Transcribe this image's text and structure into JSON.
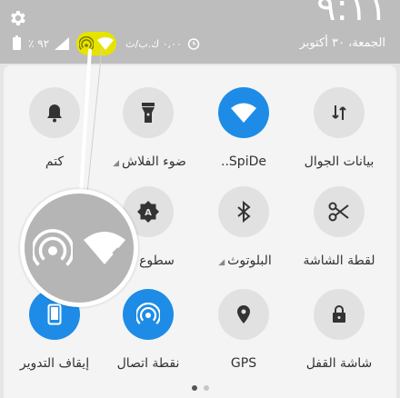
{
  "status_bar": {
    "time": "٩:١١",
    "date": "الجمعة، ٣٠ أكتوبر",
    "battery": "٪ ٩٢",
    "net_speed": "٠,٠٠ ك.ب/ث",
    "icons": [
      "gear-icon",
      "battery-icon",
      "signal-icon",
      "hotspot-icon",
      "wifi-icon",
      "alarm-icon"
    ],
    "highlight_color": "#e6e300"
  },
  "tiles": [
    {
      "label": "بيانات الجوال",
      "icon": "mobile-data-icon",
      "active": false,
      "has_arrow": false
    },
    {
      "label": "SpiDe..",
      "icon": "wifi-icon",
      "active": true,
      "has_arrow": false
    },
    {
      "label": "ضوء الفلاش",
      "icon": "flashlight-icon",
      "active": false,
      "has_arrow": true
    },
    {
      "label": "كتم",
      "icon": "bell-icon",
      "active": false,
      "has_arrow": false
    },
    {
      "label": "لقطة الشاشة",
      "icon": "scissors-icon",
      "active": false,
      "has_arrow": false
    },
    {
      "label": "البلوتوث",
      "icon": "bluetooth-icon",
      "active": false,
      "has_arrow": true
    },
    {
      "label": "سطوع تل",
      "icon": "auto-brightness-icon",
      "active": false,
      "has_arrow": false
    },
    {
      "label": "شاشة القفل",
      "icon": "lock-icon",
      "active": false,
      "has_arrow": false
    },
    {
      "label": "GPS",
      "icon": "location-icon",
      "active": false,
      "has_arrow": false
    },
    {
      "label": "نقطة اتصال",
      "icon": "hotspot-icon",
      "active": true,
      "has_arrow": false
    },
    {
      "label": "إيقاف التدوير",
      "icon": "rotation-lock-icon",
      "active": true,
      "has_arrow": false
    }
  ],
  "colors": {
    "accent": "#1e8ce6",
    "inactive": "#e1e1e1"
  },
  "pager": {
    "pages": 2,
    "current": 1
  }
}
